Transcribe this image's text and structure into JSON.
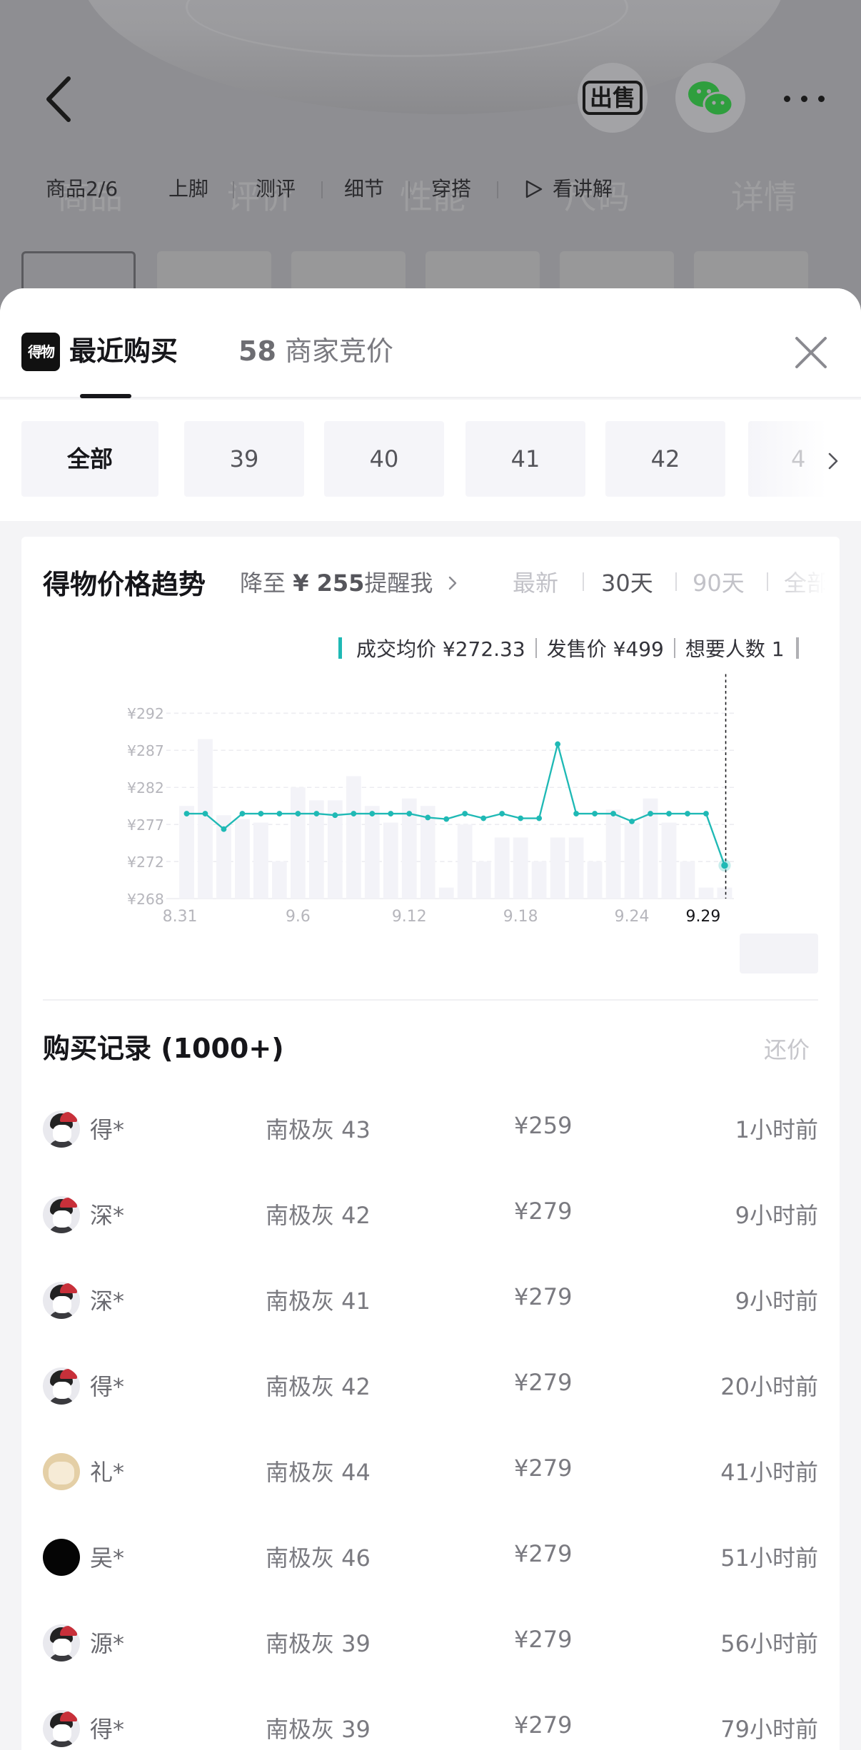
{
  "background": {
    "sell_label": "出售",
    "tabs": [
      {
        "label": "商品2/6"
      },
      {
        "label": "上脚"
      },
      {
        "label": "测评"
      },
      {
        "label": "细节"
      },
      {
        "label": "穿搭"
      },
      {
        "label": "看讲解"
      }
    ],
    "faint_tabs": [
      "商品",
      "评价",
      "性能",
      "尺码",
      "详情"
    ]
  },
  "sheet": {
    "logo_text": "得物",
    "tab_recent": "最近购买",
    "tab_bids_count": "58",
    "tab_bids_label": "商家竞价"
  },
  "sizes": [
    "全部",
    "39",
    "40",
    "41",
    "42",
    "4"
  ],
  "trend": {
    "title": "得物价格趋势",
    "remind_prefix": "降至",
    "remind_price": "¥ 255",
    "remind_suffix": "提醒我",
    "ranges": [
      "最新",
      "30天",
      "90天",
      "全部"
    ],
    "active_range": "30天"
  },
  "tooltip": {
    "avg": "成交均价 ¥272.33",
    "release": "发售价 ¥499",
    "wants": "想要人数 1"
  },
  "chart_data": {
    "type": "line",
    "x_ticks": [
      "8.31",
      "9.6",
      "9.12",
      "9.18",
      "9.24",
      "9.29"
    ],
    "highlighted_tick": "9.29",
    "y_ticks": [
      "¥292",
      "¥287",
      "¥282",
      "¥277",
      "¥272",
      "¥268"
    ],
    "ylim": [
      268,
      292
    ],
    "series": [
      {
        "values": [
          279,
          279,
          277,
          279,
          279,
          279,
          279,
          279,
          278.8,
          279,
          279,
          279,
          279,
          278.5,
          278.3,
          279,
          278.4,
          279,
          278.4,
          278.4,
          288,
          279,
          279,
          279,
          278,
          279,
          279,
          279,
          279,
          272.3
        ],
        "color": "#1fb9b5"
      }
    ],
    "volume_bars": [
      0.5,
      0.86,
      0.45,
      0.43,
      0.41,
      0.2,
      0.6,
      0.53,
      0.53,
      0.66,
      0.5,
      0.41,
      0.54,
      0.5,
      0.06,
      0.4,
      0.2,
      0.33,
      0.33,
      0.2,
      0.33,
      0.33,
      0.2,
      0.48,
      0.41,
      0.54,
      0.41,
      0.2,
      0.06,
      0.06
    ],
    "grid": true
  },
  "records": {
    "title": "购买记录 (1000+)",
    "counter_offer": "还价",
    "rows": [
      {
        "user": "得*",
        "spec": "南极灰 43",
        "price": "¥259",
        "ago": "1小时前",
        "avatar": "anime"
      },
      {
        "user": "深*",
        "spec": "南极灰 42",
        "price": "¥279",
        "ago": "9小时前",
        "avatar": "anime"
      },
      {
        "user": "深*",
        "spec": "南极灰 41",
        "price": "¥279",
        "ago": "9小时前",
        "avatar": "anime"
      },
      {
        "user": "得*",
        "spec": "南极灰 42",
        "price": "¥279",
        "ago": "20小时前",
        "avatar": "anime"
      },
      {
        "user": "礼*",
        "spec": "南极灰 44",
        "price": "¥279",
        "ago": "41小时前",
        "avatar": "cat"
      },
      {
        "user": "吴*",
        "spec": "南极灰 46",
        "price": "¥279",
        "ago": "51小时前",
        "avatar": "black"
      },
      {
        "user": "源*",
        "spec": "南极灰 39",
        "price": "¥279",
        "ago": "56小时前",
        "avatar": "anime"
      },
      {
        "user": "得*",
        "spec": "南极灰 39",
        "price": "¥279",
        "ago": "79小时前",
        "avatar": "anime"
      }
    ]
  }
}
